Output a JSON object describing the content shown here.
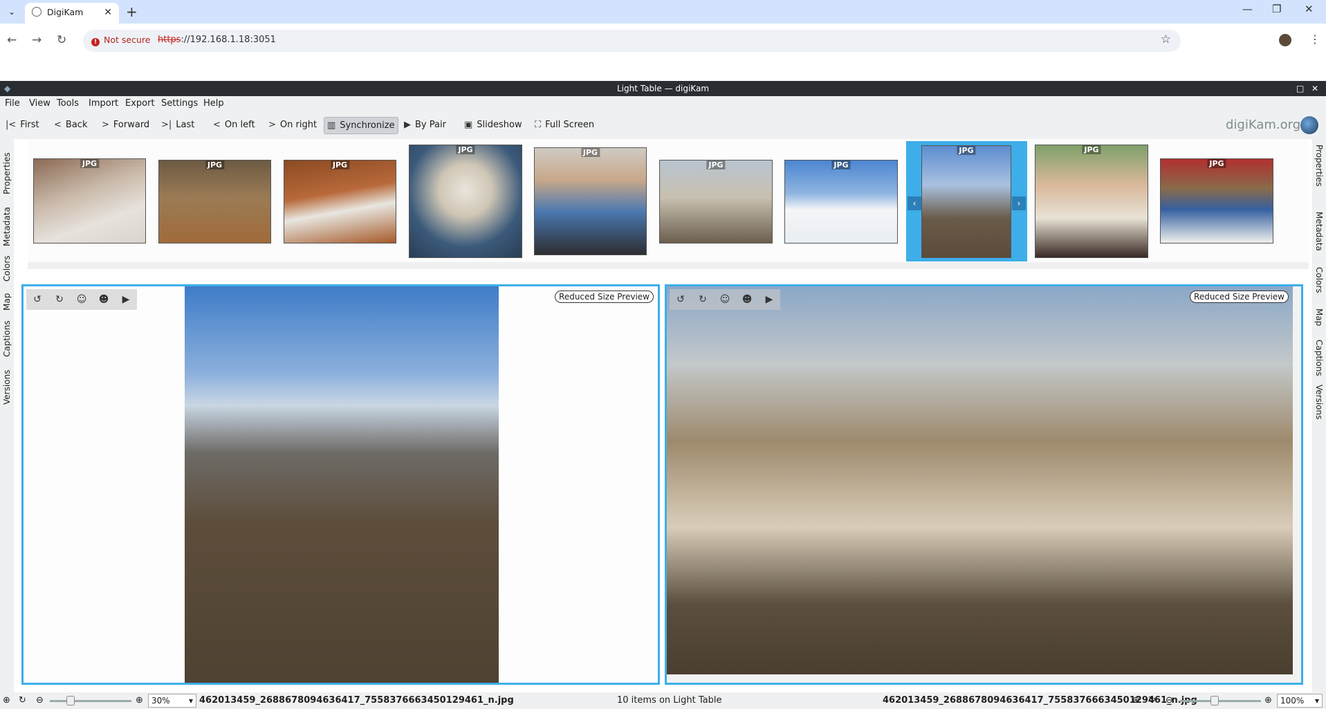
{
  "browser": {
    "tab_title": "DigiKam",
    "not_secure": "Not secure",
    "url_scheme": "https",
    "url_rest": "://192.168.1.18:3051"
  },
  "window": {
    "title": "Light Table — digiKam"
  },
  "menu": [
    "File",
    "View",
    "Tools",
    "Import",
    "Export",
    "Settings",
    "Help"
  ],
  "toolbar": {
    "first": "First",
    "back": "Back",
    "forward": "Forward",
    "last": "Last",
    "on_left": "On left",
    "on_right": "On right",
    "synchronize": "Synchronize",
    "by_pair": "By Pair",
    "slideshow": "Slideshow",
    "full_screen": "Full Screen",
    "brand": "digiKam.org"
  },
  "left_tabs": [
    "Properties",
    "Metadata",
    "Colors",
    "Map",
    "Captions",
    "Versions"
  ],
  "right_tabs": [
    "Properties",
    "Metadata",
    "Colors",
    "Map",
    "Captions",
    "Versions"
  ],
  "thumbnails": [
    {
      "format": "JPG"
    },
    {
      "format": "JPG"
    },
    {
      "format": "JPG"
    },
    {
      "format": "JPG"
    },
    {
      "format": "JPG"
    },
    {
      "format": "JPG"
    },
    {
      "format": "JPG"
    },
    {
      "format": "JPG"
    },
    {
      "format": "JPG"
    },
    {
      "format": "JPG"
    }
  ],
  "left_pane": {
    "badge": "Reduced Size Preview"
  },
  "right_pane": {
    "badge": "Reduced Size Preview"
  },
  "status": {
    "left_zoom": "30%",
    "left_file": "462013459_2688678094636417_7558376663450129461_n.jpg",
    "count": "10 items on Light Table",
    "right_file": "462013459_2688678094636417_7558376663450129461_n.jpg",
    "right_zoom": "100%"
  },
  "colors": {
    "accent": "#3daee9",
    "titlebar": "#2a2e32",
    "chrome": "#eff0f1"
  }
}
